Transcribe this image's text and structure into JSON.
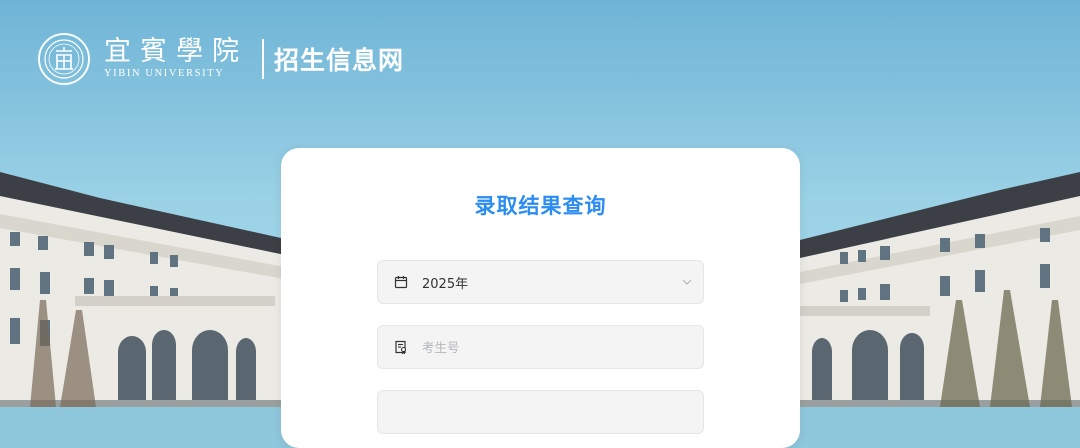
{
  "header": {
    "logo_glyph": "宜",
    "university_cn": "宜賓學院",
    "university_en": "YIBIN UNIVERSITY",
    "site_name": "招生信息网"
  },
  "query_card": {
    "title": "录取结果查询",
    "year_select": {
      "value": "2025年",
      "icon": "calendar-icon"
    },
    "exam_number_field": {
      "placeholder": "考生号",
      "value": "",
      "icon": "id-card-icon"
    }
  },
  "colors": {
    "accent": "#2b8cf1",
    "field_bg": "#f4f4f5",
    "placeholder": "#b4b6ba"
  }
}
